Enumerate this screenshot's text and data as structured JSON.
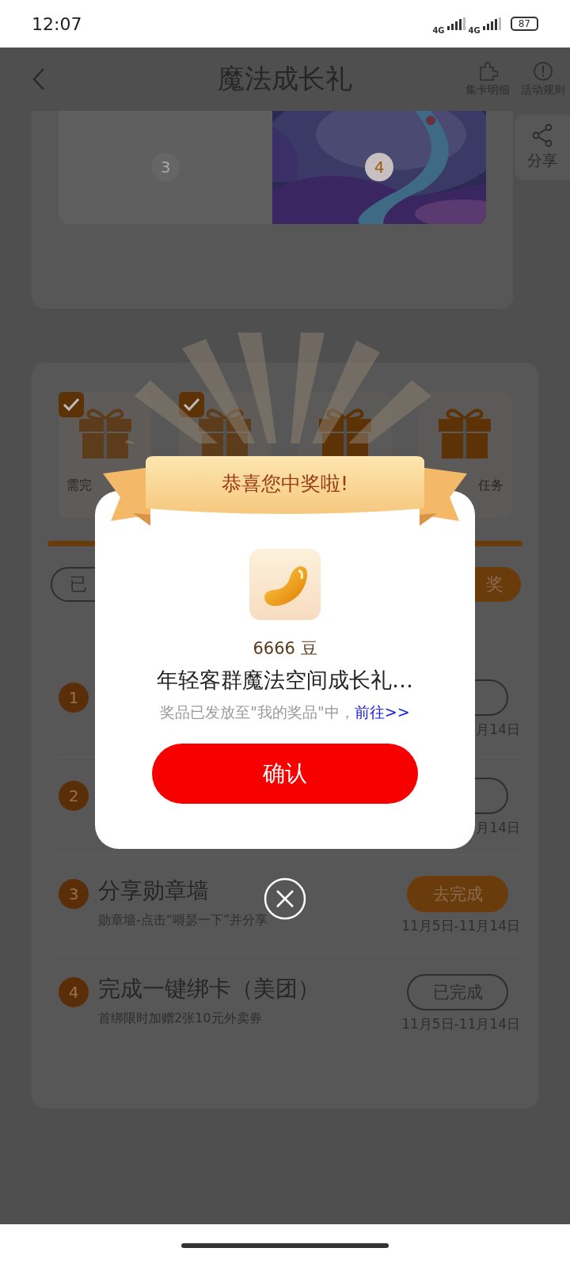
{
  "status_bar": {
    "time": "12:07",
    "network_1": "4G",
    "network_2": "4G",
    "battery": "87"
  },
  "header": {
    "title": "魔法成长礼",
    "actions": [
      {
        "label": "集卡明细",
        "kind": "puzzle"
      },
      {
        "label": "活动规则",
        "kind": "info"
      }
    ]
  },
  "share": {
    "label": "分享"
  },
  "cards": [
    {
      "number": "3",
      "kind": "locked"
    },
    {
      "number": "4",
      "kind": "picture"
    }
  ],
  "gifts": [
    {
      "checked": true,
      "label": "需完"
    },
    {
      "checked": true
    },
    {
      "checked": false
    },
    {
      "checked": false,
      "label": "任务"
    }
  ],
  "filters": [
    {
      "label": "已",
      "kind": "outline"
    },
    {
      "label": "奖",
      "kind": "filled"
    }
  ],
  "tasks": [
    {
      "number": "1",
      "kind": "outline",
      "date": "月14日"
    },
    {
      "number": "2",
      "kind": "outline",
      "date": "月14日"
    },
    {
      "number": "3",
      "title": "分享勋章墙",
      "desc": "勋章墙-点击“嘚瑟一下”并分享",
      "button": "去完成",
      "kind": "filled",
      "date": "11月5日-11月14日"
    },
    {
      "number": "4",
      "title": "完成一键绑卡（美团）",
      "desc": "首绑限时加赠2张10元外卖券",
      "button": "已完成",
      "kind": "outline",
      "date": "11月5日-11月14日"
    }
  ],
  "dialog": {
    "banner": "恭喜您中奖啦!",
    "amount": "6666 豆",
    "prize": "年轻客群魔法空间成长礼…",
    "notice": "奖品已发放至\"我的奖品\"中，",
    "link": "前往>>",
    "confirm": "确认"
  }
}
